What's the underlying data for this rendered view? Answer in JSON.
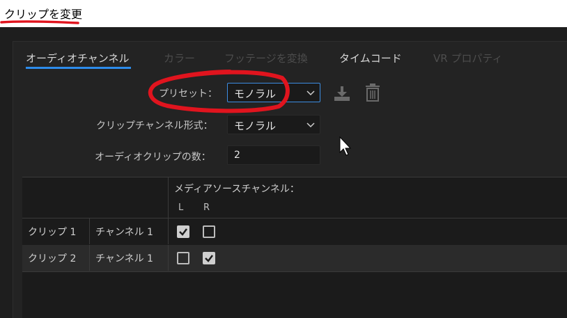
{
  "window": {
    "title": "クリップを変更"
  },
  "tabs": [
    {
      "label": "オーディオチャンネル",
      "active": true,
      "enabled": true
    },
    {
      "label": "カラー",
      "active": false,
      "enabled": false
    },
    {
      "label": "フッテージを変換",
      "active": false,
      "enabled": false
    },
    {
      "label": "タイムコード",
      "active": false,
      "enabled": true
    },
    {
      "label": "VR プロパティ",
      "active": false,
      "enabled": false
    }
  ],
  "form": {
    "preset_label": "プリセット：",
    "preset_value": "モノラル",
    "format_label": "クリップチャンネル形式：",
    "format_value": "モノラル",
    "clip_count_label": "オーディオクリップの数：",
    "clip_count_value": "2"
  },
  "grid": {
    "header": "メディアソースチャンネル：",
    "channels": [
      "L",
      "R"
    ],
    "rows": [
      {
        "clip": "クリップ 1",
        "channel": "チャンネル 1",
        "L": true,
        "R": false
      },
      {
        "clip": "クリップ 2",
        "channel": "チャンネル 1",
        "L": false,
        "R": true
      }
    ]
  },
  "icons": {
    "save_preset": "download-icon",
    "delete_preset": "trash-icon",
    "dropdown": "chevron-down-icon",
    "check": "checkmark-icon",
    "cursor": "mouse-pointer-icon"
  },
  "colors": {
    "accent": "#2d8ceb",
    "annotation": "#e0141e",
    "background": "#1e1e1e"
  }
}
